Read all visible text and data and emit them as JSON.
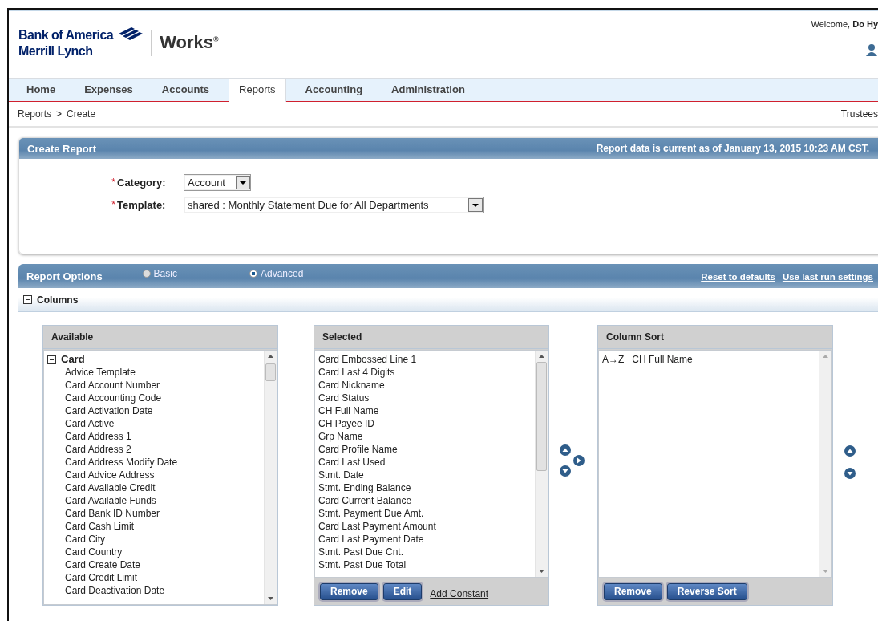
{
  "header": {
    "logo_line1": "Bank of America",
    "logo_line2": "Merrill Lynch",
    "product": "Works",
    "product_mark": "®",
    "welcome": "Welcome, **Do Hy**"
  },
  "nav": {
    "tabs": [
      {
        "label": "Home",
        "selected": false
      },
      {
        "label": "Expenses",
        "selected": false
      },
      {
        "label": "Accounts",
        "selected": false
      },
      {
        "label": "Reports",
        "selected": true
      },
      {
        "label": "Accounting",
        "selected": false
      },
      {
        "label": "Administration",
        "selected": false
      }
    ]
  },
  "breadcrumb": {
    "items": [
      "Reports",
      "Create"
    ],
    "separator": ">",
    "org": "Trustees"
  },
  "create_report": {
    "title": "Create Report",
    "data_note": "Report data is current as of January 13, 2015 10:23 AM CST.",
    "fields": [
      {
        "label": "Category:",
        "required_mark": "*",
        "value": "Account"
      },
      {
        "label": "Template:",
        "required_mark": "*",
        "value": "shared : Monthly Statement Due for All Departments"
      }
    ]
  },
  "report_options": {
    "title": "Report Options",
    "modes": [
      {
        "label": "Basic",
        "selected": false
      },
      {
        "label": "Advanced",
        "selected": true
      }
    ],
    "links": [
      "Reset to defaults",
      "Use last run settings"
    ]
  },
  "columns_section": {
    "title": "Columns",
    "expanded": true
  },
  "available": {
    "title": "Available",
    "tree": [
      {
        "label": "Card",
        "expanded": true,
        "children": [
          {
            "label": "Advice Template"
          },
          {
            "label": "Card Account Number"
          },
          {
            "label": "Card Accounting Code"
          },
          {
            "label": "Card Activation Date"
          },
          {
            "label": "Card Active"
          },
          {
            "label": "Card Address 1"
          },
          {
            "label": "Card Address 2"
          },
          {
            "label": "Card Address Modify Date"
          },
          {
            "label": "Card Advice Address"
          },
          {
            "label": "Card Available Credit"
          },
          {
            "label": "Card Available Funds"
          },
          {
            "label": "Card Bank ID Number"
          },
          {
            "label": "Card Cash Limit"
          },
          {
            "label": "Card City"
          },
          {
            "label": "Card Country"
          },
          {
            "label": "Card Create Date"
          },
          {
            "label": "Card Credit Limit"
          },
          {
            "label": "Card Deactivation Date"
          }
        ]
      }
    ]
  },
  "selected": {
    "title": "Selected",
    "items": [
      "Card Embossed Line 1",
      "Card Last 4 Digits",
      "Card Nickname",
      "Card Status",
      "CH Full Name",
      "CH Payee ID",
      "Grp Name",
      "Card Profile Name",
      "Card Last Used",
      "Stmt. Date",
      "Stmt. Ending Balance",
      "Card Current Balance",
      "Stmt. Payment Due Amt.",
      "Card Last Payment Amount",
      "Card Last Payment Date",
      "Stmt. Past Due Cnt.",
      "Stmt. Past Due Total"
    ],
    "buttons": [
      "Remove",
      "Edit"
    ],
    "link": "Add Constant"
  },
  "column_sort": {
    "title": "Column Sort",
    "items": [
      {
        "direction": "A→Z",
        "name": "CH Full Name"
      }
    ],
    "buttons": [
      "Remove",
      "Reverse Sort"
    ]
  }
}
